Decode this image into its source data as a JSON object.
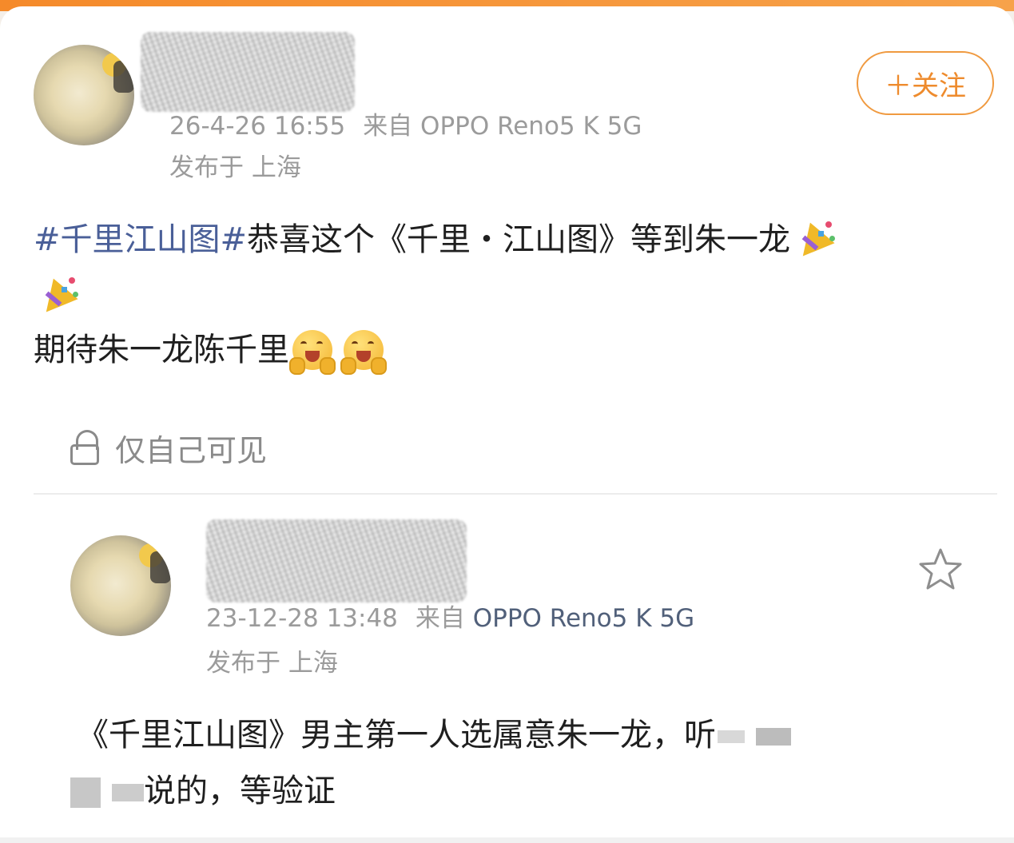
{
  "post1": {
    "timestamp": "26-4-26 16:55",
    "source": "来自 OPPO Reno5 K 5G",
    "location": "发布于 上海",
    "follow_label": "＋关注",
    "hashtag": "#千里江山图#",
    "line1": "恭喜这个《千里・江山图》等到朱一龙",
    "line2": "期待朱一龙陈千里",
    "visibility": "仅自己可见"
  },
  "post2": {
    "timestamp": "23-12-28 13:48",
    "source_prefix": "来自",
    "device": "OPPO Reno5 K 5G",
    "location": "发布于 上海",
    "line1": "《千里江山图》男主第一人选属意朱一龙，听",
    "line2": "说的，等验证"
  },
  "colors": {
    "accent_orange": "#ee8b2d",
    "hashtag_blue": "#4a5f98",
    "meta_gray": "#9b9b9b"
  },
  "icons": [
    "lock-icon",
    "star-icon",
    "party-popper-emoji",
    "happy-face-emoji"
  ]
}
